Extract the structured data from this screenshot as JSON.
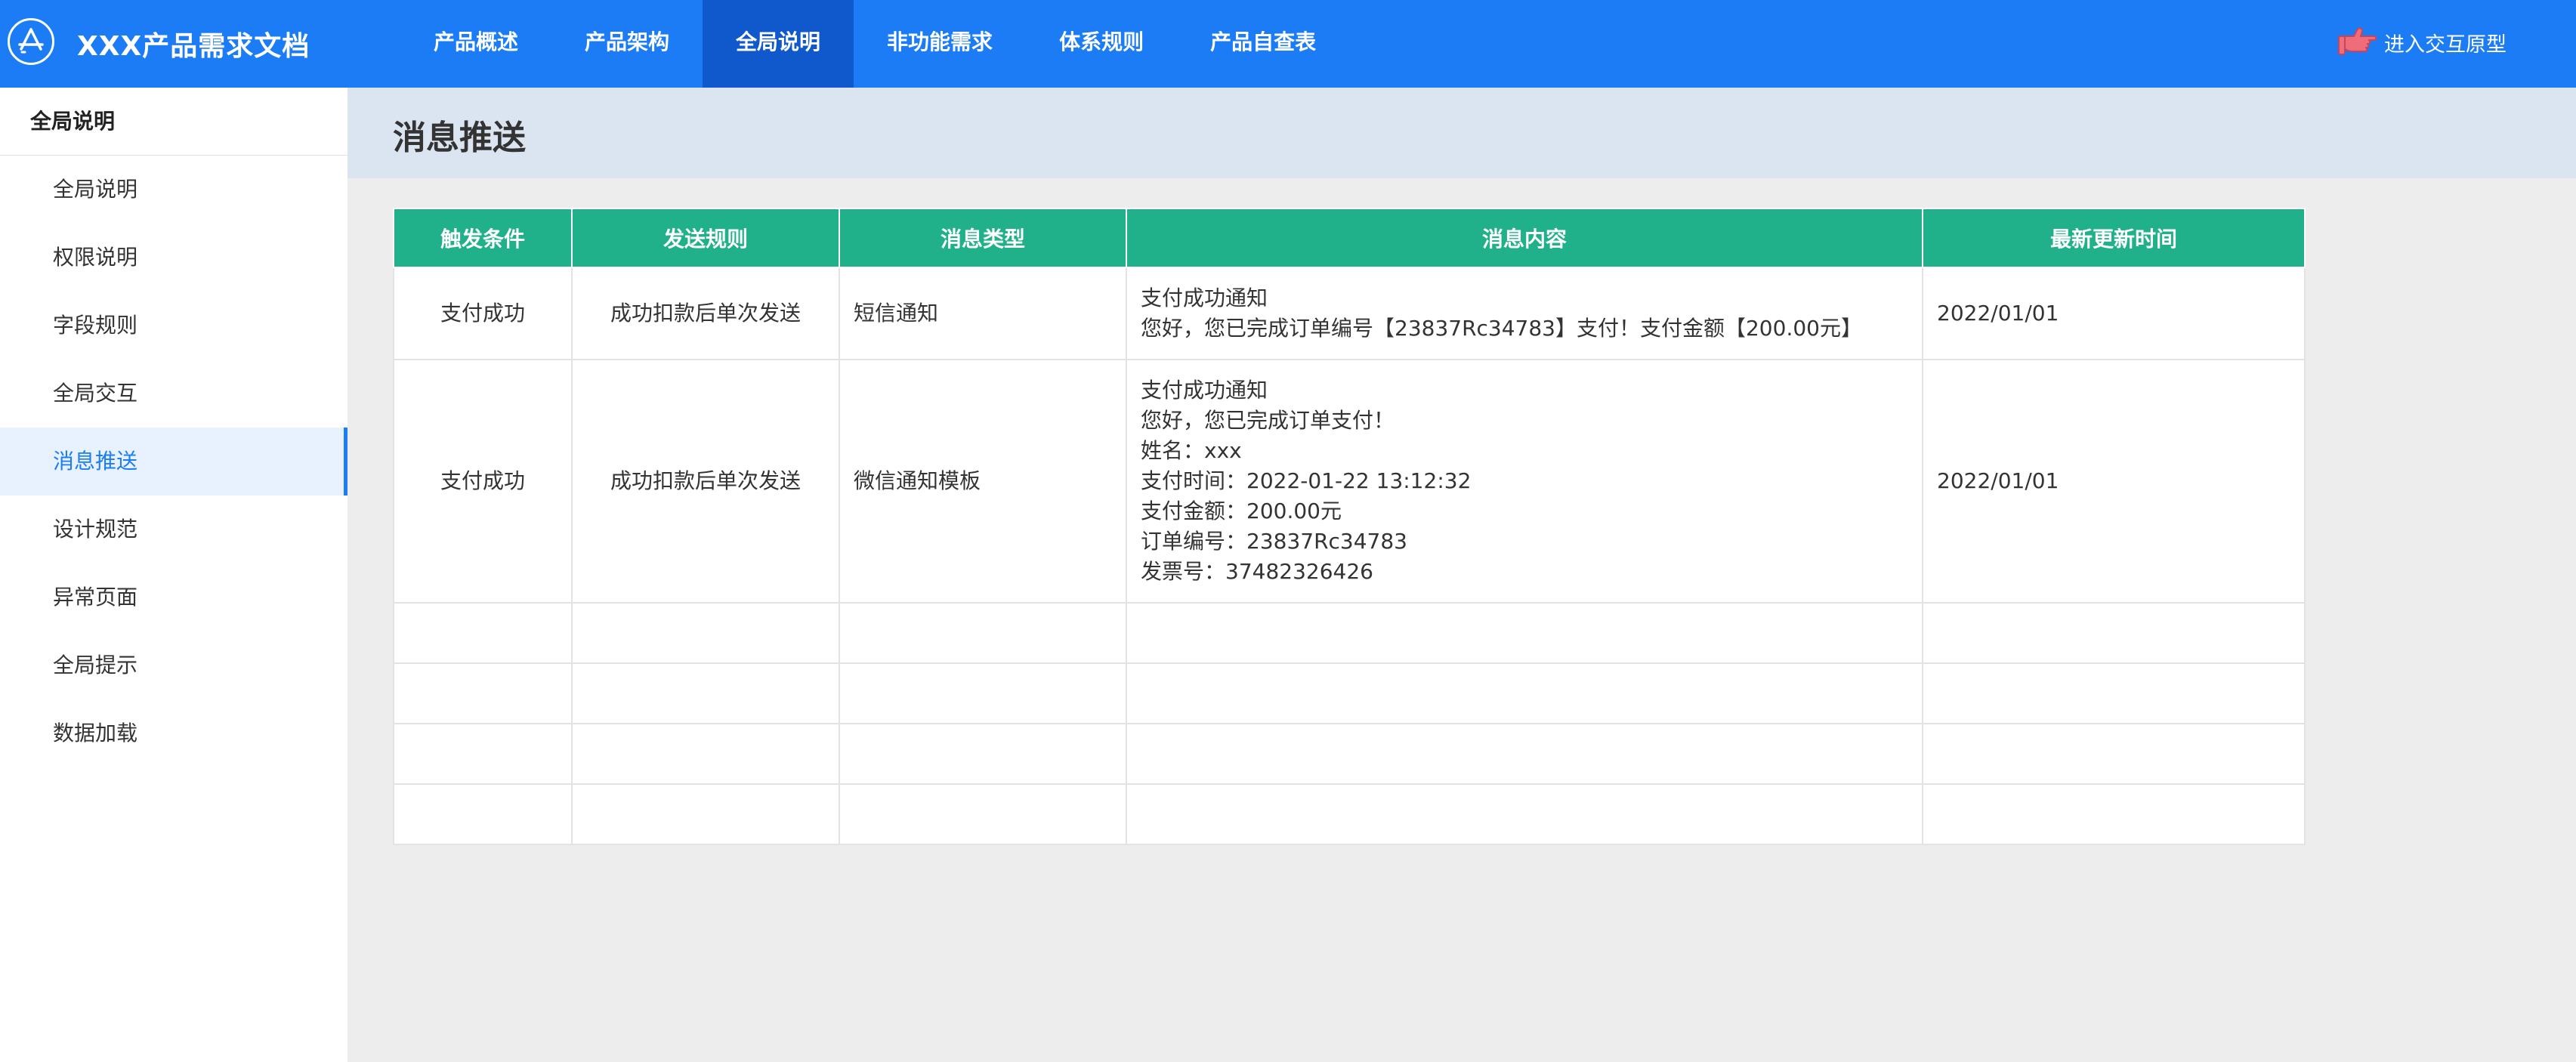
{
  "header": {
    "app_title": "XXX产品需求文档",
    "nav": [
      {
        "label": "产品概述",
        "active": false
      },
      {
        "label": "产品架构",
        "active": false
      },
      {
        "label": "全局说明",
        "active": true
      },
      {
        "label": "非功能需求",
        "active": false
      },
      {
        "label": "体系规则",
        "active": false
      },
      {
        "label": "产品自查表",
        "active": false
      }
    ],
    "prototype_link": "进入交互原型",
    "logo_icon": "app-store-icon",
    "prototype_icon": "pointing-hand-icon"
  },
  "sidebar": {
    "heading": "全局说明",
    "items": [
      {
        "label": "全局说明"
      },
      {
        "label": "权限说明"
      },
      {
        "label": "字段规则"
      },
      {
        "label": "全局交互"
      },
      {
        "label": "消息推送",
        "active": true
      },
      {
        "label": "设计规范"
      },
      {
        "label": "异常页面"
      },
      {
        "label": "全局提示"
      },
      {
        "label": "数据加载"
      }
    ]
  },
  "main": {
    "title": "消息推送",
    "table": {
      "headers": [
        "触发条件",
        "发送规则",
        "消息类型",
        "消息内容",
        "最新更新时间"
      ],
      "rows": [
        {
          "trigger": "支付成功",
          "rule": "成功扣款后单次发送",
          "type": "短信通知",
          "content": [
            "支付成功通知",
            "您好，您已完成订单编号【23837Rc34783】支付！支付金额【200.00元】"
          ],
          "updated": "2022/01/01"
        },
        {
          "trigger": "支付成功",
          "rule": "成功扣款后单次发送",
          "type": "微信通知模板",
          "content": [
            "支付成功通知",
            "您好，您已完成订单支付！",
            "姓名：xxx",
            "支付时间：2022-01-22 13:12:32",
            "支付金额：200.00元",
            "订单编号：23837Rc34783",
            "发票号：37482326426"
          ],
          "updated": "2022/01/01"
        }
      ],
      "empty_rows": 4
    }
  },
  "colors": {
    "header_bg": "#1c7cf6",
    "nav_active_bg": "#1059cc",
    "table_header_bg": "#21b18a",
    "sidebar_active_bg": "#e8f2fe",
    "page_head_bg": "#dbe4f1"
  }
}
